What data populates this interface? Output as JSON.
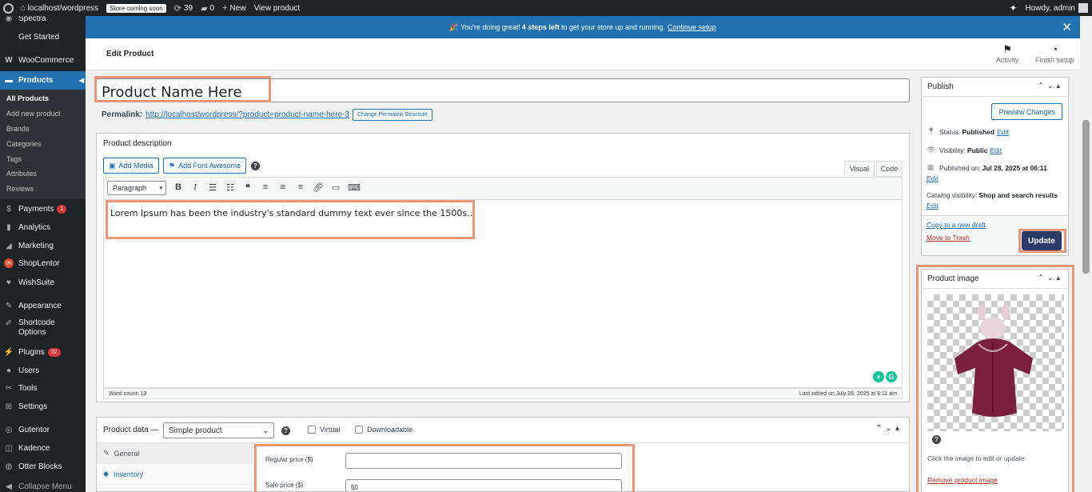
{
  "adminbar": {
    "site": "localhost/wordpress",
    "store_badge": "Store coming soon",
    "updates": "39",
    "comments": "0",
    "new": "New",
    "view": "View product",
    "howdy": "Howdy, admin"
  },
  "sidebar": {
    "items": [
      {
        "label": "Spectra"
      },
      {
        "label": "Get Started"
      },
      {
        "label": "WooCommerce"
      },
      {
        "label": "Products"
      },
      {
        "label": "Payments",
        "badge": "1"
      },
      {
        "label": "Analytics"
      },
      {
        "label": "Marketing"
      },
      {
        "label": "ShopLentor"
      },
      {
        "label": "WishSuite"
      },
      {
        "label": "Appearance"
      },
      {
        "label": "Shortcode Options"
      },
      {
        "label": "Plugins",
        "badge": "32"
      },
      {
        "label": "Users"
      },
      {
        "label": "Tools"
      },
      {
        "label": "Settings"
      },
      {
        "label": "Gutentor"
      },
      {
        "label": "Kadence"
      },
      {
        "label": "Otter Blocks"
      },
      {
        "label": "Collapse Menu"
      }
    ],
    "submenu": [
      "All Products",
      "Add new product",
      "Brands",
      "Categories",
      "Tags",
      "Attributes",
      "Reviews"
    ]
  },
  "notice": {
    "prefix": "🎉 You're doing great! ",
    "bold": "4 steps left",
    "suffix": " to get your store up and running.",
    "link": "Continue setup"
  },
  "header": {
    "title": "Edit Product",
    "activity": "Activity",
    "finish": "Finish setup"
  },
  "product": {
    "title": "Product Name Here",
    "permalink_label": "Permalink:",
    "permalink_url": "http://localhost/wordpress/?product=product-name-here-3",
    "change_permalink": "Change Permalink Structure"
  },
  "description": {
    "title": "Product description",
    "add_media": "Add Media",
    "add_font_awesome": "Add Font Awesome",
    "tab_visual": "Visual",
    "tab_code": "Code",
    "format": "Paragraph",
    "content": "Lorem Ipsum has been the industry's standard dummy text ever since the 1500s...",
    "word_count": "Word count: 13",
    "last_edited": "Last edited on July 28, 2025 at 6:11 am"
  },
  "product_data": {
    "label": "Product data —",
    "type": "Simple product",
    "virtual": "Virtual",
    "downloadable": "Downloadable",
    "tabs": [
      "General",
      "Inventory"
    ],
    "regular_price_label": "Regular price ($)",
    "regular_price": "",
    "sale_price_label": "Sale price ($)",
    "sale_price": "50"
  },
  "publish": {
    "title": "Publish",
    "preview": "Preview Changes",
    "status_label": "Status:",
    "status": "Published",
    "visibility_label": "Visibility:",
    "visibility": "Public",
    "published_label": "Published on:",
    "published": "Jul 28, 2025 at 06:11",
    "catalog_label": "Catalog visibility:",
    "catalog": "Shop and search results",
    "edit": "Edit",
    "copy": "Copy to a new draft",
    "trash": "Move to Trash",
    "update": "Update"
  },
  "product_image": {
    "title": "Product image",
    "hint": "Click the image to edit or update",
    "remove": "Remove product image"
  },
  "colors": {
    "admin_bar": "#1d2327",
    "accent": "#2271b1",
    "highlight": "#e8957a",
    "update_button": "#2b3a67"
  }
}
